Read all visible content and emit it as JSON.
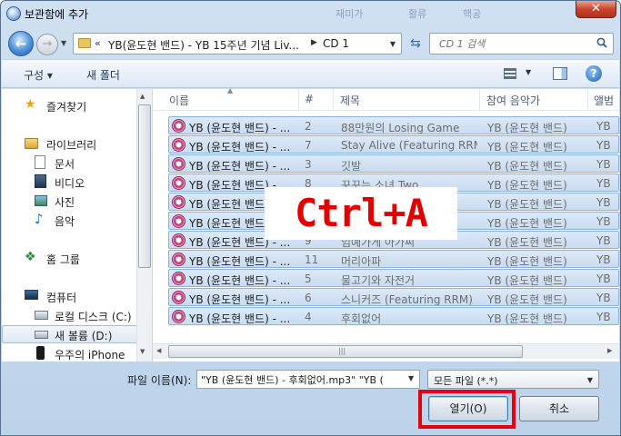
{
  "window": {
    "title": "보관함에 추가",
    "close": "✕",
    "ghost_tabs": [
      "재미가",
      "활류",
      "핵공"
    ]
  },
  "address": {
    "arrows": "«",
    "path": "YB(윤도현 밴드) - YB 15주년 기념 Liv...",
    "last": "CD 1"
  },
  "search": {
    "placeholder": "CD 1 검색"
  },
  "toolbar": {
    "organize": "구성 ▾",
    "new_folder": "새 폴더",
    "help": "?"
  },
  "nav": {
    "favorites": "즐겨찾기",
    "libraries": "라이브러리",
    "documents": "문서",
    "videos": "비디오",
    "pictures": "사진",
    "music": "음악",
    "homegroup": "홈 그룹",
    "computer": "컴퓨터",
    "local_disk": "로컬 디스크 (C:)",
    "new_volume": "새 볼륨 (D:)",
    "iphone": "우주의 iPhone"
  },
  "columns": {
    "name": "이름",
    "num": "#",
    "title": "제목",
    "artist": "참여 음악가",
    "album": "앨범"
  },
  "files": [
    {
      "name": "YB (윤도현 밴드) - ...",
      "num": "2",
      "title": "88만원의 Losing Game",
      "artist": "YB (윤도현 밴드)",
      "extra": "YB"
    },
    {
      "name": "YB (윤도현 밴드) - ...",
      "num": "7",
      "title": "Stay Alive (Featuring RRM)",
      "artist": "YB (윤도현 밴드)",
      "extra": "YB"
    },
    {
      "name": "YB (윤도현 밴드) - ...",
      "num": "3",
      "title": "깃발",
      "artist": "YB (윤도현 밴드)",
      "extra": "YB"
    },
    {
      "name": "YB (윤도현 밴드) - ...",
      "num": "8",
      "title": "꾸꾸는 소녀 Two",
      "artist": "YB (윤도현 밴드)",
      "extra": "YB"
    },
    {
      "name": "YB (윤도현 밴드) - ...",
      "num": "",
      "title": "",
      "artist": "YB (윤도현 밴드)",
      "extra": "YB"
    },
    {
      "name": "YB (윤도현 밴드) - ...",
      "num": "",
      "title": "",
      "artist": "YB (윤도현 밴드)",
      "extra": "YB"
    },
    {
      "name": "YB (윤도현 밴드) - ...",
      "num": "9",
      "title": "임예가게 아가씨",
      "artist": "YB (윤도현 밴드)",
      "extra": "YB"
    },
    {
      "name": "YB (윤도현 밴드) - ...",
      "num": "11",
      "title": "머리아파",
      "artist": "YB (윤도현 밴드)",
      "extra": "YB"
    },
    {
      "name": "YB (윤도현 밴드) - ...",
      "num": "5",
      "title": "물고기와 자전거",
      "artist": "YB (윤도현 밴드)",
      "extra": "YB"
    },
    {
      "name": "YB (윤도현 밴드) - ...",
      "num": "6",
      "title": "스니커즈 (Featuring RRM)",
      "artist": "YB (윤도현 밴드)",
      "extra": "YB"
    },
    {
      "name": "YB (윤도현 밴드) - ...",
      "num": "4",
      "title": "후회없어",
      "artist": "YB (윤도현 밴드)",
      "extra": "YB"
    }
  ],
  "overlay": {
    "text": "Ctrl+A",
    "color": "#e00000"
  },
  "filename": {
    "label": "파일 이름(N):",
    "value": "\"YB (윤도현 밴드) - 후회없어.mp3\" \"YB ("
  },
  "filetype": {
    "value": "모든 파일 (*.*)"
  },
  "buttons": {
    "open": "열기(O)",
    "cancel": "취소"
  },
  "colors": {
    "highlight": "#e60012",
    "selection": "#cce0f5"
  }
}
